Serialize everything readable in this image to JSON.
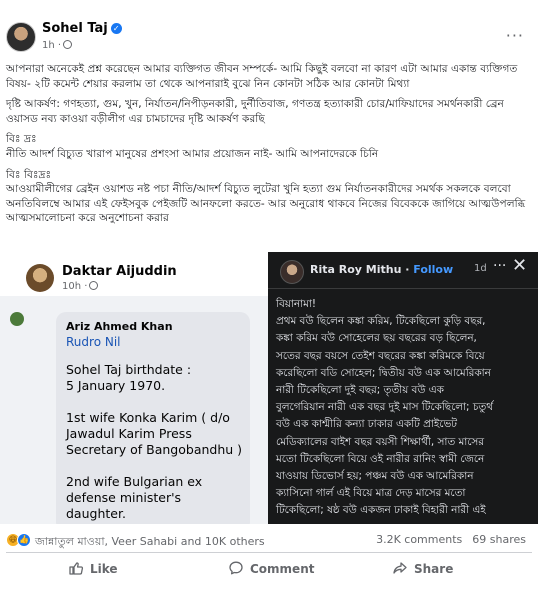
{
  "post": {
    "author": "Sohel Taj",
    "time": "1h ·",
    "more": "···",
    "paragraphs": [
      "আপনারা অনেকেই প্রশ্ন করেছেন আমার ব্যক্তিগত  জীবন সম্পর্কে- আমি কিছুই বলবো না কারণ এটা আমার একান্ত ব্যক্তিগত বিষয়- ২টি কমেন্ট শেয়ার করলাম তা থেকে আপনারাই বুঝে নিন কোনটা সঠিক আর কোনটা মিথ্যা",
      "দৃষ্টি আকর্ষণ: গণহত্যা, গুম, খুন, নির্যাতন/নিপীড়নকারী, দুর্নীতিবাজ, গণতন্ত্র হত্যাকারী চোর/মাফিয়াদের সমর্থনকারী ব্রেন ওয়াসড নব্য কাওয়া বড়ীলীগ এর চামচাদের দৃষ্টি আকর্ষণ করছি",
      "বিঃ দ্রঃ\nনীতি আদর্শ বিচ্যুত খারাপ মানুষের প্রশংসা আমার প্রয়োজন নাই- আমি আপনাদেরকে চিনি",
      "বিঃ বিঃদ্রঃ\nআওয়ামীলীগের ব্রেইন ওয়াশড নষ্ট পচা নীতি/আদর্শ বিচ্যুত লুটেরা খুনি হত্যা গুম নির্যাতনকারীদের সমর্থক সকলকে বলবো অনতিবিলম্বে আমার এই ফেইসবুক পেইজটি আনফলো করতে- আর অনুরোধ থাকবে নিজের বিবেককে জাগিয়ে আত্মউপলব্ধি আত্মসমালোচনা করে অনুশোচনা করার"
    ]
  },
  "left_screenshot": {
    "name": "Daktar Aijuddin",
    "time": "10h ·",
    "comment_author": "Ariz Ahmed Khan",
    "mention": "Rudro Nil",
    "lines": [
      "Sohel Taj birthdate :",
      " 5 January 1970.",
      "",
      "1st wife Konka Karim ( d/o",
      "Jawadul Karim Press",
      "Secretary of Bangobandhu )",
      "",
      "2nd wife Bulgarian ex",
      "defense minister's daughter."
    ]
  },
  "right_screenshot": {
    "name": "Rita Roy Mithu",
    "follow": "Follow",
    "time": "1d",
    "more": "···",
    "close": "✕",
    "lines": [
      "বিয়ানামা!",
      "প্রথম বউ ছিলেন কঙ্কা করিম, টিকেছিলো কুড়ি বছর,",
      "কঙ্কা করিম বউ সোহেলের ছয় বছরের বড় ছিলেন,",
      "সতের বছর বয়সে তেইশ বছরের কঙ্কা করিমকে বিয়ে",
      "করেছিলো বডি সোহেল; দ্বিতীয় বউ এক আমেরিকান",
      "নারী টিকেছিলো দুই বছর; তৃতীয় বউ এক",
      "বুলগেরিয়ান নারী এক বছর দুই মাস টিকেছিলো; চতুর্থ",
      "বউ এক কাশ্মীরি কন্যা ঢাকার একটি প্রাইভেট",
      "মেডিক্যালের বাইশ বছর বয়সী শিক্ষার্থী, সাত মাসের",
      "মতো টিকেছিলো বিয়ে ওই নারীর রানিং স্বামী জেনে",
      "যাওয়ায় ডিভোর্স হয়; পঞ্চম বউ এক আমেরিকান",
      "ক্যাসিনো গার্ল এই বিয়ে মাত্র দেড় মাসের মতো",
      "টিকেছিলো; ষষ্ঠ বউ একজন ঢাকাই বিহারী নারী এই"
    ]
  },
  "stats": {
    "reactions_text": "জান্নাতুল মাওয়া, Veer Sahabi and 10K others",
    "comments": "3.2K comments",
    "shares": "69 shares",
    "reaction_icons": [
      "haha-icon",
      "like-icon"
    ]
  },
  "actions": {
    "like": "Like",
    "comment": "Comment",
    "share": "Share"
  },
  "colors": {
    "brand": "#1877f2",
    "dark_panel": "#18191a",
    "mention": "#1a55b5"
  }
}
